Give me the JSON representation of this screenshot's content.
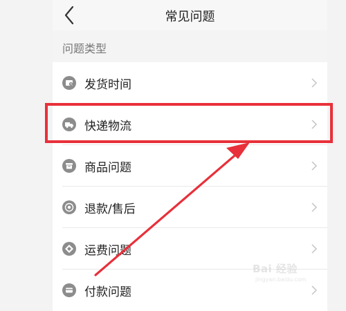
{
  "header": {
    "title": "常见问题",
    "back_icon": "chevron-left-icon"
  },
  "section": {
    "label": "问题类型"
  },
  "items": [
    {
      "label": "发货时间",
      "icon": "delivery-time-icon"
    },
    {
      "label": "快递物流",
      "icon": "truck-icon"
    },
    {
      "label": "商品问题",
      "icon": "product-box-icon"
    },
    {
      "label": "退款/售后",
      "icon": "refund-icon"
    },
    {
      "label": "运费问题",
      "icon": "shipping-fee-icon"
    },
    {
      "label": "付款问题",
      "icon": "payment-icon"
    }
  ],
  "annotation": {
    "highlighted_item": "快递物流",
    "color": "#e8303a"
  },
  "watermark": {
    "logo": "Bai 经验",
    "url": "jingyan.baidu.com"
  },
  "colors": {
    "icon_gray": "#8c8c8c",
    "annotation_red": "#e8303a"
  }
}
